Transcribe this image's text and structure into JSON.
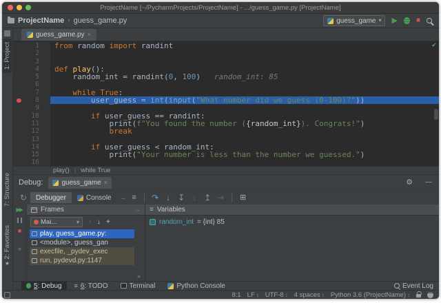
{
  "window": {
    "title": "ProjectName [~/PycharmProjects/ProjectName] - .../guess_game.py [ProjectName]"
  },
  "navbar": {
    "project": "ProjectName",
    "file": "guess_game.py",
    "run_config": "guess_game"
  },
  "stripe": {
    "project": "1: Project",
    "structure": "7: Structure",
    "favorites": "2: Favorites"
  },
  "editor": {
    "tab": "guess_game.py",
    "breadcrumb": {
      "left": "play()",
      "right": "while True"
    },
    "lines": [
      {
        "n": 1,
        "segs": [
          [
            "kw",
            "from "
          ],
          [
            "pl",
            "random "
          ],
          [
            "kw",
            "import "
          ],
          [
            "pl",
            "randint"
          ]
        ]
      },
      {
        "n": 2,
        "segs": []
      },
      {
        "n": 3,
        "segs": []
      },
      {
        "n": 4,
        "segs": [
          [
            "kw",
            "def "
          ],
          [
            "fn",
            "play"
          ],
          [
            "pl",
            "():"
          ]
        ]
      },
      {
        "n": 5,
        "segs": [
          [
            "pl",
            "    random_int = randint("
          ],
          [
            "num",
            "0"
          ],
          [
            "pl",
            ", "
          ],
          [
            "num",
            "100"
          ],
          [
            "pl",
            ")"
          ],
          [
            "hint",
            "   random_int: 85"
          ]
        ]
      },
      {
        "n": 6,
        "segs": []
      },
      {
        "n": 7,
        "segs": [
          [
            "pl",
            "    "
          ],
          [
            "kw",
            "while "
          ],
          [
            "kw",
            "True"
          ],
          [
            "pl",
            ":"
          ]
        ]
      },
      {
        "n": 8,
        "breakpoint": true,
        "highlight": true,
        "segs": [
          [
            "pl",
            "        user_guess = "
          ],
          [
            "builtin",
            "int"
          ],
          [
            "pl",
            "("
          ],
          [
            "builtin",
            "input"
          ],
          [
            "pl",
            "("
          ],
          [
            "str",
            "\"What number did we guess (0-100)?\""
          ],
          [
            "pl",
            "))"
          ]
        ]
      },
      {
        "n": 9,
        "segs": []
      },
      {
        "n": 10,
        "segs": [
          [
            "pl",
            "        "
          ],
          [
            "kw",
            "if "
          ],
          [
            "pl",
            "user_guess == randint:"
          ]
        ]
      },
      {
        "n": 11,
        "segs": [
          [
            "pl",
            "            print("
          ],
          [
            "str",
            "f\"You found the number ("
          ],
          [
            "interp",
            "{random_int}"
          ],
          [
            "str",
            "). Congrats!\""
          ],
          [
            "pl",
            ")"
          ]
        ]
      },
      {
        "n": 12,
        "segs": [
          [
            "pl",
            "            "
          ],
          [
            "kw",
            "break"
          ]
        ]
      },
      {
        "n": 13,
        "segs": []
      },
      {
        "n": 14,
        "segs": [
          [
            "pl",
            "        "
          ],
          [
            "kw",
            "if "
          ],
          [
            "pl",
            "user_guess < random_int:"
          ]
        ]
      },
      {
        "n": 15,
        "segs": [
          [
            "pl",
            "            print("
          ],
          [
            "str",
            "\"Your number is less than the number we guessed.\""
          ],
          [
            "pl",
            ")"
          ]
        ]
      },
      {
        "n": 16,
        "segs": []
      }
    ]
  },
  "debug": {
    "label": "Debug:",
    "tab": "guess_game",
    "debugger_tab": "Debugger",
    "console_tab": "Console",
    "frames_header": "Frames",
    "variables_header": "Variables",
    "thread": "Mai...",
    "frames": [
      {
        "label": "play, guess_game.py:",
        "state": "selected"
      },
      {
        "label": "<module>, guess_gan",
        "state": "normal"
      },
      {
        "label": "execfile, _pydev_exec",
        "state": "lib"
      },
      {
        "label": "run, pydevd.py:1147",
        "state": "lib"
      }
    ],
    "variables": [
      {
        "name": "random_int",
        "value": "= {int} 85"
      }
    ]
  },
  "toolbar_bottom": {
    "items": [
      {
        "label": "5: Debug",
        "icon": "debug",
        "active": true
      },
      {
        "label": "6: TODO",
        "icon": "todo",
        "active": false
      },
      {
        "label": "Terminal",
        "icon": "terminal",
        "active": false
      },
      {
        "label": "Python Console",
        "icon": "python",
        "active": false
      }
    ],
    "event_log": "Event Log"
  },
  "statusbar": {
    "position": "8:1",
    "line_ending": "LF",
    "encoding": "UTF-8",
    "indent": "4 spaces",
    "interpreter": "Python 3.6 (ProjectName)"
  },
  "icons": {
    "gear": "⚙",
    "close": "×",
    "minimize": "—",
    "check": "✔",
    "play": "▶",
    "stop": "■",
    "rerun": "↻",
    "step_over": "↷",
    "step_into": "↓",
    "step_into_my_code": "↧",
    "force_step_into": "↓",
    "step_out": "↥",
    "run_to_cursor": "⇥",
    "evaluate": "⊞",
    "hamburger": "≡",
    "up": "↑",
    "down": "↓",
    "plus": "+",
    "dropdown": "▾",
    "chevron": "›",
    "star": "★",
    "updown": "↕",
    "more": "»",
    "pin": "→",
    "resume": "▶▶",
    "variables": "≡",
    "todo": "≡",
    "prompt": "→"
  },
  "colors": {
    "execution_line_blue": "#2a5fa8",
    "frame_selection_blue": "#2d65c0",
    "run_green": "#499c54",
    "stop_red": "#c75450",
    "breakpoint_red": "#d25252",
    "keyword_orange": "#cc7832",
    "string_green": "#6a8759",
    "number_blue": "#6897bb"
  }
}
